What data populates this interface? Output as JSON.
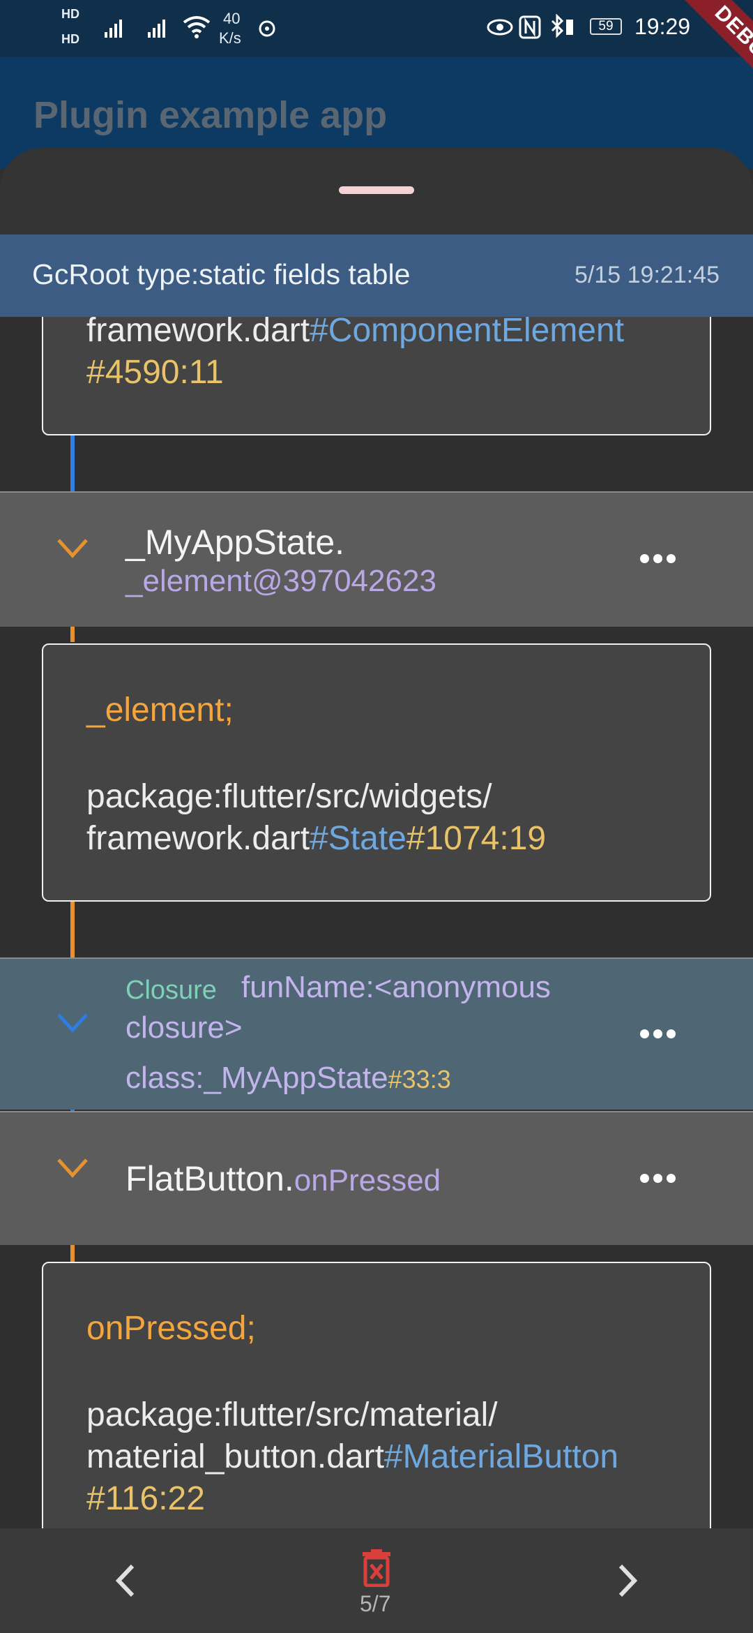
{
  "status_bar": {
    "network_left": "HD 4G 4G",
    "speed_value": "40",
    "speed_unit": "K/s",
    "battery": "59",
    "time": "19:29",
    "debug_banner": "DEBUG"
  },
  "app_bar": {
    "title": "Plugin example app"
  },
  "sheet": {
    "gcroot_title": "GcRoot type:static fields table",
    "gcroot_time": "5/15 19:21:45"
  },
  "chain": {
    "card1": {
      "line1_prefix": "framework.dart",
      "line1_link": "#ComponentElement",
      "line2": "#4590:11"
    },
    "row1": {
      "name": "_MyAppState.",
      "field": "_element@397042623"
    },
    "card2": {
      "field": "_element;",
      "path1": "package:flutter/src/widgets/",
      "path2_prefix": "framework.dart",
      "path2_link": "#State",
      "path2_loc": "#1074:19"
    },
    "row2": {
      "kind": "Closure",
      "fun_line1": "funName:<anonymous",
      "fun_line2": "closure>",
      "class": "class:_MyAppState",
      "class_loc": "#33:3"
    },
    "row3": {
      "name": "FlatButton.",
      "field": "onPressed"
    },
    "card3": {
      "field": "onPressed;",
      "path1": "package:flutter/src/material/",
      "path2_prefix": "material_button.dart",
      "path2_link": "#MaterialButton",
      "path3": "#116:22"
    }
  },
  "bottom_nav": {
    "page": "5/7"
  },
  "colors": {
    "accent_blue": "#2f7de1",
    "accent_orange": "#e6922e",
    "delete_red": "#d9403c"
  }
}
